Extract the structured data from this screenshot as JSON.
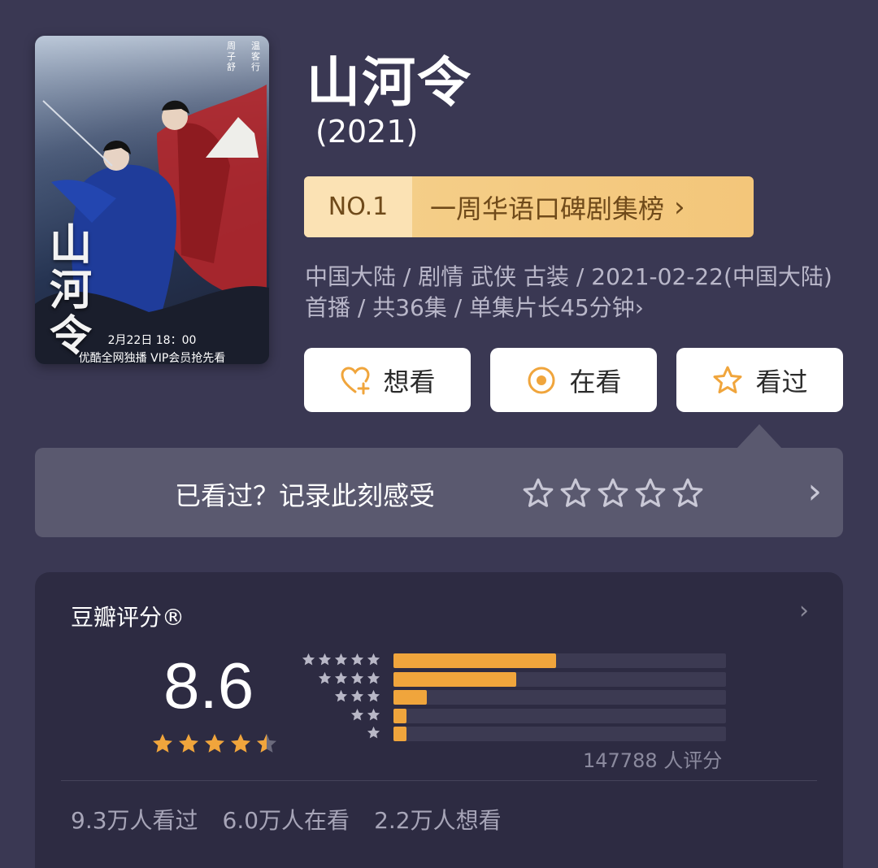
{
  "poster": {
    "title_glyphs": "山河令",
    "actor_left": "周子舒",
    "actor_right": "温客行",
    "date": "2月22日 18：00",
    "note": "优酷全网独播 VIP会员抢先看"
  },
  "header": {
    "title": "山河令",
    "year": "(2021)"
  },
  "ranking": {
    "number": "NO.1",
    "list_name": "一周华语口碑剧集榜",
    "chevron": "›"
  },
  "meta": {
    "line": "中国大陆 / 剧情 武侠 古装 / 2021-02-22(中国大陆) 首播 / 共36集 / 单集片长45分钟",
    "chevron": "›"
  },
  "actions": {
    "want": {
      "label": "想看",
      "icon": "heart-plus-icon"
    },
    "doing": {
      "label": "在看",
      "icon": "target-circle-icon"
    },
    "done": {
      "label": "看过",
      "icon": "star-outline-icon"
    }
  },
  "record": {
    "prompt": "已看过？记录此刻感受",
    "star_count": 5,
    "chevron": "›"
  },
  "rating": {
    "title": "豆瓣评分®",
    "chevron": "›",
    "score": "8.6",
    "stars_value": 4.5,
    "distribution": [
      {
        "stars": 5,
        "fraction": 0.49
      },
      {
        "stars": 4,
        "fraction": 0.37
      },
      {
        "stars": 3,
        "fraction": 0.1
      },
      {
        "stars": 2,
        "fraction": 0.04
      },
      {
        "stars": 1,
        "fraction": 0.04
      }
    ],
    "rater_count": "147788 人评分",
    "stats": {
      "watched": "9.3万人看过",
      "watching": "6.0万人在看",
      "want": "2.2万人想看"
    }
  },
  "colors": {
    "background": "#3a3853",
    "accent": "#f0a53c",
    "rank_badge": "#f5d08c",
    "card": "#2d2b42"
  }
}
